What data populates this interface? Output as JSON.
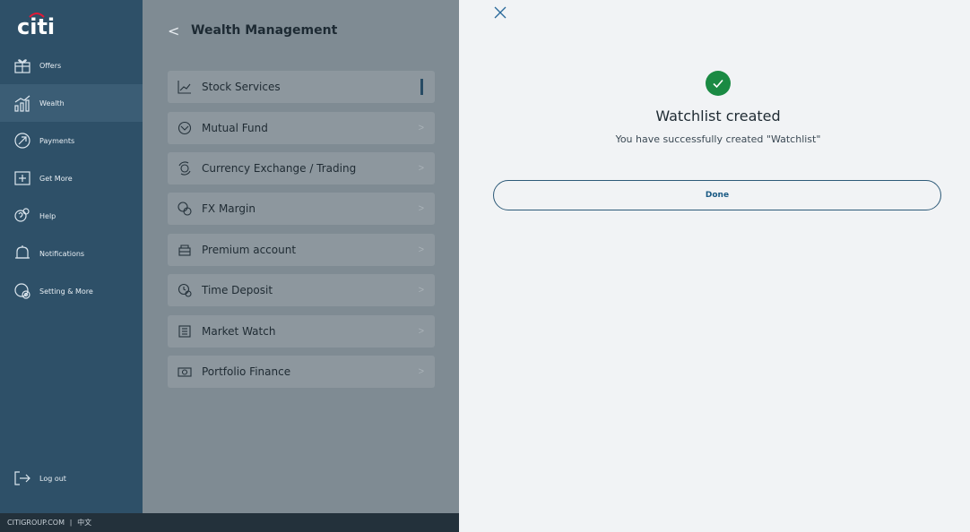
{
  "brand": {
    "logo_text": "citi"
  },
  "sidebar": {
    "items": [
      {
        "label": "Offers",
        "icon": "gift-icon"
      },
      {
        "label": "Wealth",
        "icon": "wealth-chart-icon",
        "active": true
      },
      {
        "label": "Payments",
        "icon": "payments-arrow-icon"
      },
      {
        "label": "Get More",
        "icon": "plus-box-icon"
      },
      {
        "label": "Help",
        "icon": "help-question-icon"
      },
      {
        "label": "Notifications",
        "icon": "bell-icon"
      },
      {
        "label": "Setting & More",
        "icon": "settings-gear-icon"
      }
    ],
    "logout_label": "Log out"
  },
  "footer": {
    "site_link": "CITIGROUP.COM",
    "separator": "|",
    "language": "中文"
  },
  "wealth_panel": {
    "back_glyph": "<",
    "title": "Wealth Management",
    "items": [
      {
        "label": "Stock Services",
        "icon": "line-chart-icon",
        "active": true
      },
      {
        "label": "Mutual Fund",
        "icon": "mutual-fund-icon"
      },
      {
        "label": "Currency Exchange / Trading",
        "icon": "currency-exchange-icon"
      },
      {
        "label": "FX Margin",
        "icon": "fx-margin-icon"
      },
      {
        "label": "Premium account",
        "icon": "premium-account-icon"
      },
      {
        "label": "Time Deposit",
        "icon": "time-deposit-icon"
      },
      {
        "label": "Market Watch",
        "icon": "market-watch-icon"
      },
      {
        "label": "Portfolio Finance",
        "icon": "portfolio-finance-icon"
      }
    ],
    "chevron": ">"
  },
  "dialog": {
    "title": "Watchlist created",
    "message": "You have successfully created \"Watchlist\"",
    "done_label": "Done",
    "success_color": "#1a8a43"
  },
  "colors": {
    "sidebar_bg": "#2e5068",
    "footer_bg": "#23313b",
    "overlay_bg": "#7f8b93",
    "accent": "#1a5a84"
  }
}
